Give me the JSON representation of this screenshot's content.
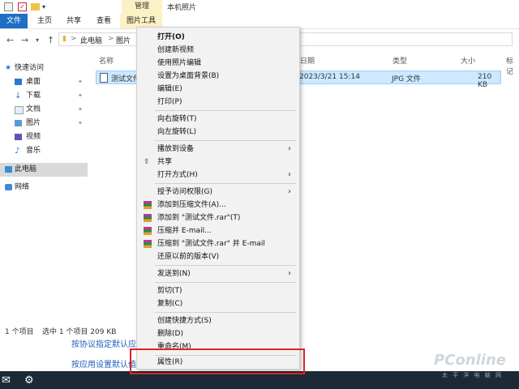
{
  "window": {
    "title": "本机照片",
    "contextual_tab_header": "管理",
    "tabs": {
      "file": "文件",
      "home": "主页",
      "share": "共享",
      "view": "查看",
      "picture_tools": "图片工具"
    },
    "breadcrumb": [
      "此电脑",
      "图片"
    ],
    "breadcrumb_sep": ">"
  },
  "sidebar": {
    "quick_access": "快速访问",
    "items": [
      "桌面",
      "下载",
      "文档",
      "图片",
      "视频",
      "音乐"
    ],
    "this_pc": "此电脑",
    "network": "网络"
  },
  "columns": {
    "name": "名称",
    "date": "日期",
    "type": "类型",
    "size": "大小",
    "tags": "标记"
  },
  "file": {
    "name": "测试文件",
    "date": "2023/3/21 15:14",
    "type": "JPG 文件",
    "size": "210 KB"
  },
  "status": {
    "count": "1 个项目",
    "selected": "选中 1 个项目  209 KB"
  },
  "background_links": [
    "按协议指定默认应",
    "按应用设置默认值"
  ],
  "watermark": {
    "brand": "PConline",
    "sub": "太 平 洋 电 脑 网"
  },
  "menu": {
    "open": "打开(O)",
    "new_video": "创建新视频",
    "edit_photos": "使用照片编辑",
    "set_wallpaper": "设置为桌面背景(B)",
    "edit": "编辑(E)",
    "print": "打印(P)",
    "rotate_right": "向右旋转(T)",
    "rotate_left": "向左旋转(L)",
    "cast": "播放到设备",
    "share": "共享",
    "open_with": "打开方式(H)",
    "grant_access": "授予访问权限(G)",
    "add_archive": "添加到压缩文件(A)...",
    "add_rar": "添加到 \"测试文件.rar\"(T)",
    "compress_email": "压缩并 E-mail...",
    "compress_rar_email": "压缩到 \"测试文件.rar\" 并 E-mail",
    "restore": "还原以前的版本(V)",
    "send_to": "发送到(N)",
    "cut": "剪切(T)",
    "copy": "复制(C)",
    "shortcut": "创建快捷方式(S)",
    "delete": "删除(D)",
    "rename": "重命名(M)",
    "properties": "属性(R)",
    "submenu_arrow": "›"
  },
  "colors": {
    "accent": "#1e6fc6",
    "highlight_box": "#e02323",
    "selection": "#cde8ff"
  }
}
